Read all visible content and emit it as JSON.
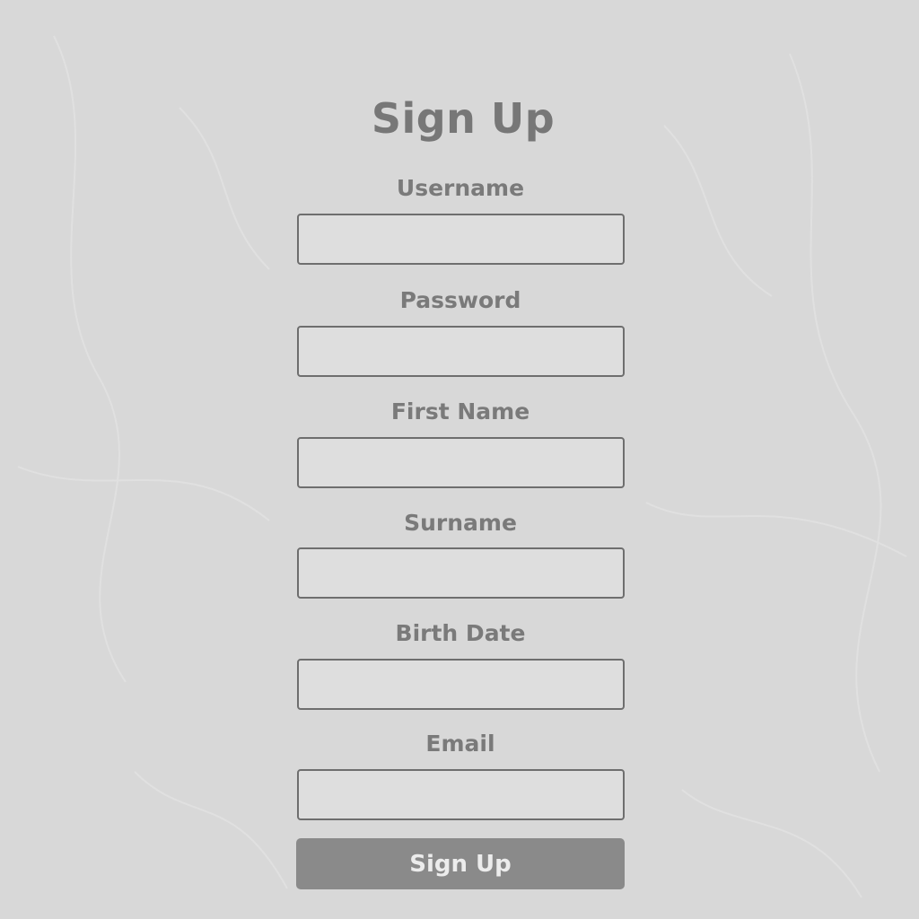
{
  "form": {
    "title": "Sign Up",
    "fields": [
      {
        "label": "Username",
        "value": "",
        "placeholder": ""
      },
      {
        "label": "Password",
        "value": "",
        "placeholder": ""
      },
      {
        "label": "First Name",
        "value": "",
        "placeholder": ""
      },
      {
        "label": "Surname",
        "value": "",
        "placeholder": ""
      },
      {
        "label": "Birth Date",
        "value": "",
        "placeholder": ""
      },
      {
        "label": "Email",
        "value": "",
        "placeholder": ""
      }
    ],
    "submit_label": "Sign Up"
  },
  "colors": {
    "background": "#d8d8d8",
    "text": "#777777",
    "input_border": "#6e6e6e",
    "button": "#8a8a8a",
    "button_text": "#ececec"
  }
}
